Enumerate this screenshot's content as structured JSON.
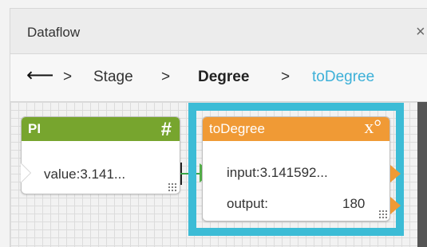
{
  "window": {
    "title": "Dataflow",
    "close_glyph": "×"
  },
  "breadcrumb": {
    "back_glyph": "⟵",
    "separator": ">",
    "items": [
      "Stage",
      "Degree",
      "toDegree"
    ],
    "colors": {
      "active": "#3cb0d8",
      "bold": "#222222",
      "normal": "#333333"
    }
  },
  "nodes": {
    "pi": {
      "title": "PI",
      "icon": "hash-icon",
      "icon_glyph": "#",
      "header_color": "#77a52e",
      "port_value": "value:3.141..."
    },
    "to_degree": {
      "title": "toDegree",
      "icon": "x-degree-icon",
      "icon_glyph": "x°",
      "header_color": "#f09a35",
      "input_label": "input:3.141592...",
      "output_label": "output:",
      "output_value": "180"
    }
  },
  "selection": {
    "color": "#3cbcd6"
  }
}
